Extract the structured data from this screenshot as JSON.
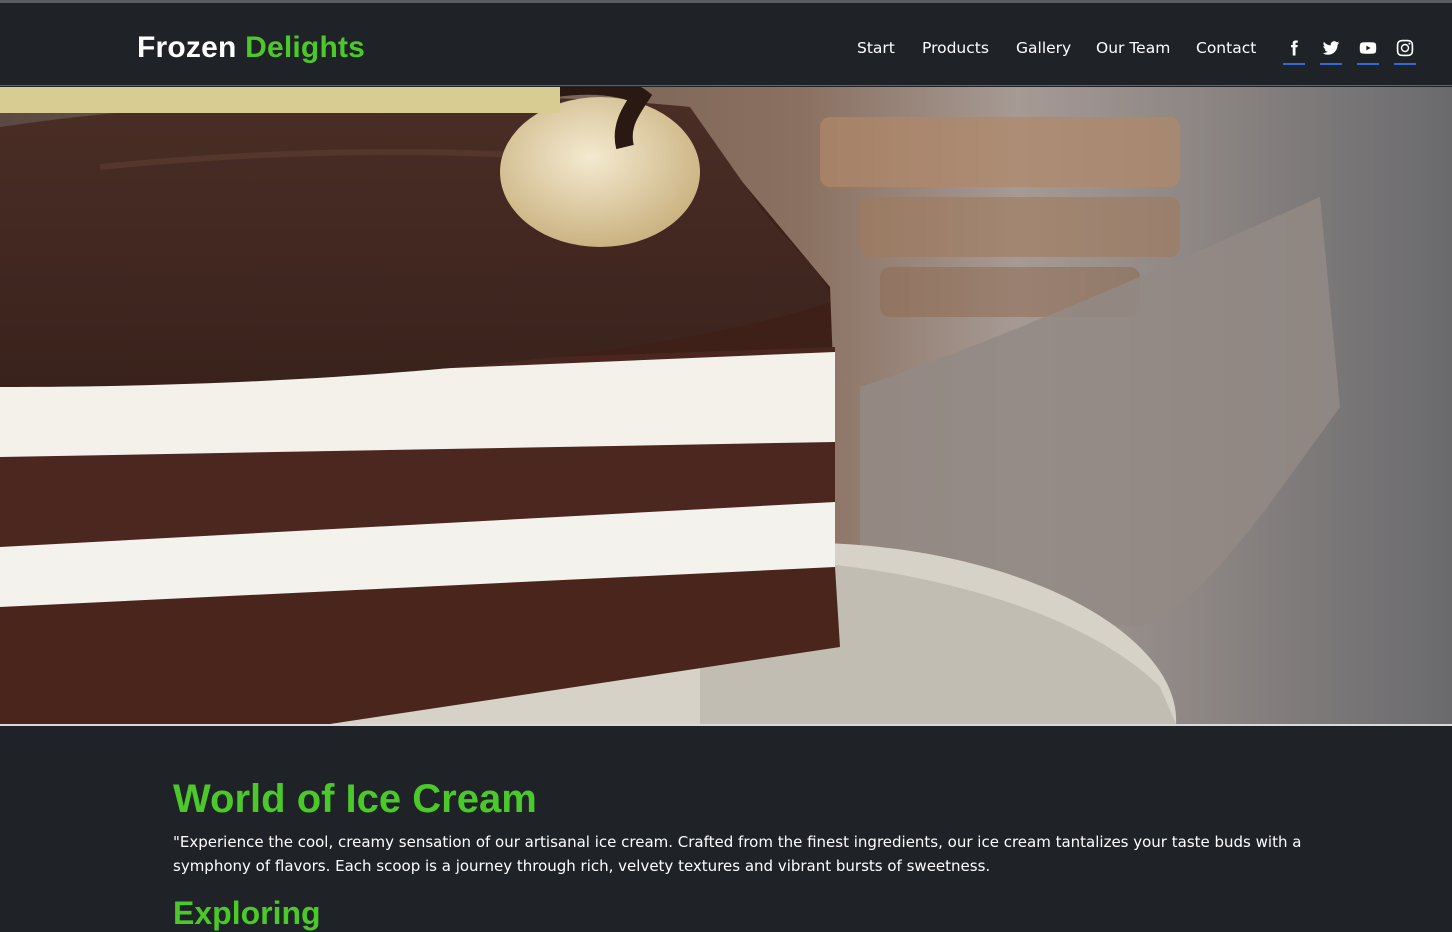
{
  "brand": {
    "name_main": "Frozen",
    "name_accent": "Delights"
  },
  "nav": {
    "items": [
      {
        "label": "Start"
      },
      {
        "label": "Products"
      },
      {
        "label": "Gallery"
      },
      {
        "label": "Our Team"
      },
      {
        "label": "Contact"
      }
    ]
  },
  "social": [
    {
      "icon": "facebook-icon"
    },
    {
      "icon": "twitter-icon"
    },
    {
      "icon": "youtube-icon"
    },
    {
      "icon": "instagram-icon"
    }
  ],
  "colors": {
    "accent": "#4cc92a",
    "background": "#1f2226",
    "underline": "#2f6bd6"
  },
  "main": {
    "title": "World of Ice Cream",
    "description": "\"Experience the cool, creamy sensation of our artisanal ice cream. Crafted from the finest ingredients, our ice cream tantalizes your taste buds with a symphony of flavors. Each scoop is a journey through rich, velvety textures and vibrant bursts of sweetness.",
    "next_heading": "Exploring"
  }
}
